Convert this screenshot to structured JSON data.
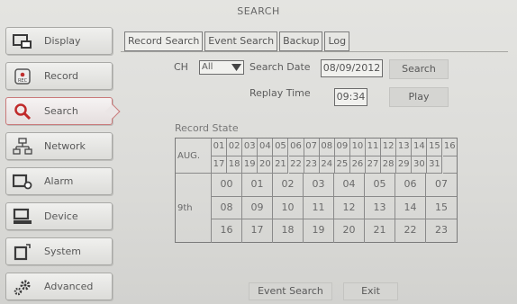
{
  "window": {
    "title": "SEARCH"
  },
  "sidebar": {
    "items": [
      {
        "label": "Display",
        "icon": "display-icon"
      },
      {
        "label": "Record",
        "icon": "record-icon"
      },
      {
        "label": "Search",
        "icon": "search-icon",
        "active": true
      },
      {
        "label": "Network",
        "icon": "network-icon"
      },
      {
        "label": "Alarm",
        "icon": "alarm-icon"
      },
      {
        "label": "Device",
        "icon": "device-icon"
      },
      {
        "label": "System",
        "icon": "system-icon"
      },
      {
        "label": "Advanced",
        "icon": "gear-icon"
      }
    ]
  },
  "tabs": [
    {
      "label": "Record Search",
      "active": true
    },
    {
      "label": "Event Search"
    },
    {
      "label": "Backup"
    },
    {
      "label": "Log"
    }
  ],
  "form": {
    "ch_label": "CH",
    "ch_value": "All",
    "search_date_label": "Search Date",
    "search_date_value": "08/09/2012",
    "search_button": "Search",
    "replay_time_label": "Replay Time",
    "replay_time_value": "09:34",
    "play_button": "Play"
  },
  "record_state": {
    "title": "Record State",
    "month_label": "AUG.",
    "days_row1": [
      "01",
      "02",
      "03",
      "04",
      "05",
      "06",
      "07",
      "08",
      "09",
      "10",
      "11",
      "12",
      "13",
      "14",
      "15",
      "16"
    ],
    "days_row2": [
      "17",
      "18",
      "19",
      "20",
      "21",
      "22",
      "23",
      "24",
      "25",
      "26",
      "27",
      "28",
      "29",
      "30",
      "31",
      ""
    ],
    "day_label": "9th",
    "hours": [
      [
        "00",
        "01",
        "02",
        "03",
        "04",
        "05",
        "06",
        "07"
      ],
      [
        "08",
        "09",
        "10",
        "11",
        "12",
        "13",
        "14",
        "15"
      ],
      [
        "16",
        "17",
        "18",
        "19",
        "20",
        "21",
        "22",
        "23"
      ]
    ]
  },
  "footer": {
    "event_search_button": "Event Search",
    "exit_button": "Exit"
  },
  "colors": {
    "background": "#dcdcd9",
    "active_border": "#c97a7a",
    "grid_line": "#8a8a8a"
  }
}
